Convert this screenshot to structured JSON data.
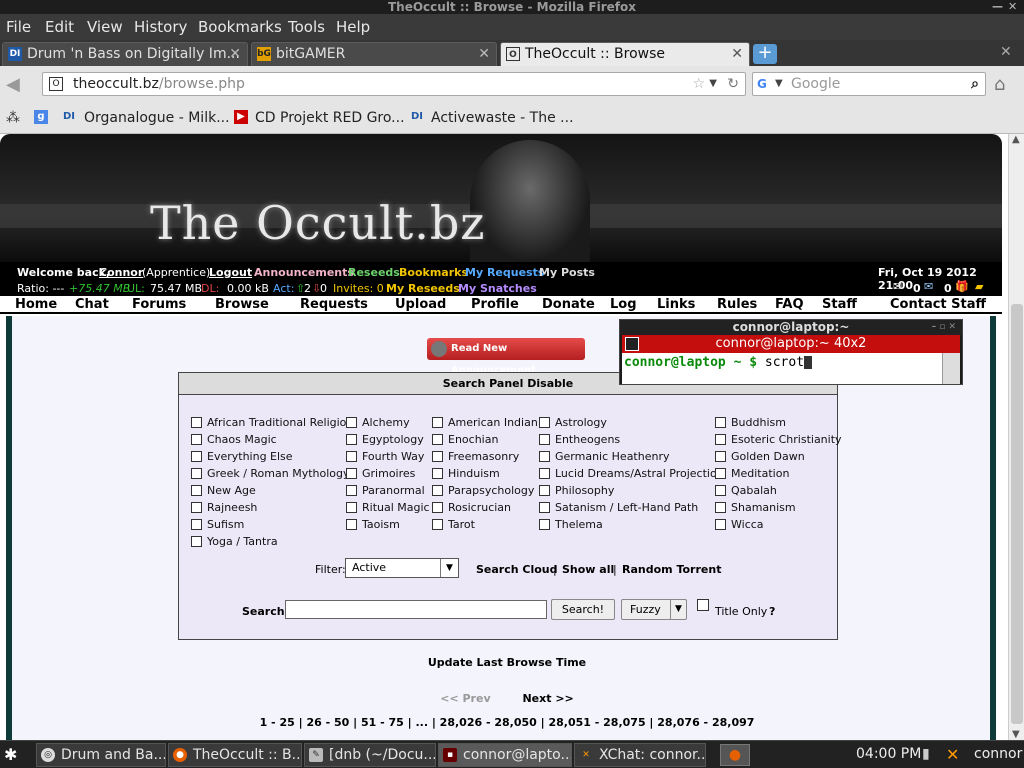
{
  "window": {
    "title": "TheOccult :: Browse - Mozilla Firefox"
  },
  "menu": [
    "File",
    "Edit",
    "View",
    "History",
    "Bookmarks",
    "Tools",
    "Help"
  ],
  "tabs": [
    {
      "label": "Drum 'n Bass on Digitally Im...",
      "icon": "DI"
    },
    {
      "label": "bitGAMER",
      "icon": "bG"
    },
    {
      "label": "TheOccult :: Browse",
      "icon": "O"
    }
  ],
  "nav": {
    "url_host": "theoccult.bz",
    "url_path": "/browse.php",
    "search_placeholder": "Google"
  },
  "bookmarks": [
    {
      "label": "Organalogue - Milk...",
      "icon": "DI"
    },
    {
      "label": "CD Projekt RED Gro...",
      "icon": "▶"
    },
    {
      "label": "Activewaste - The ...",
      "icon": "DI"
    }
  ],
  "site": {
    "logo": "The Occult.bz",
    "userbar": {
      "welcome": "Welcome back,",
      "user": "Connor",
      "rank": "(Apprentice)",
      "logout": "Logout",
      "announcements": "Announcements",
      "reseeds": "Reseeds",
      "bookmarks": "Bookmarks",
      "my_requests": "My Requests",
      "my_posts": "My Posts",
      "date": "Fri, Oct 19 2012 21:00",
      "ratio_label": "Ratio: ---",
      "ratio_value": "+75.47 MB",
      "ul_label": "UL:",
      "ul_value": "75.47 MB",
      "dl_label": "DL:",
      "dl_value": "0.00 kB",
      "act_label": "Act:",
      "act_up": "2",
      "act_down": "0",
      "invites": "Invites: 0",
      "my_reseeds": "My Reseeds",
      "my_snatches": "My Snatches",
      "msg_count": "0",
      "gift_count": "0"
    },
    "nav": [
      "Home",
      "Chat",
      "Forums",
      "Browse",
      "Requests",
      "Upload",
      "Profile",
      "Donate",
      "Log",
      "Links",
      "Rules",
      "FAQ",
      "Staff",
      "Contact Staff"
    ],
    "announce_button": "Read New Announcement.",
    "panel_title": "Search Panel Disable",
    "categories": [
      [
        "African Traditional Religion",
        "Chaos Magic",
        "Everything Else",
        "Greek / Roman Mythology",
        "New Age",
        "Rajneesh",
        "Sufism",
        "Yoga / Tantra"
      ],
      [
        "Alchemy",
        "Egyptology",
        "Fourth Way",
        "Grimoires",
        "Paranormal",
        "Ritual Magic",
        "Taoism"
      ],
      [
        "American Indian",
        "Enochian",
        "Freemasonry",
        "Hinduism",
        "Parapsychology",
        "Rosicrucian",
        "Tarot"
      ],
      [
        "Astrology",
        "Entheogens",
        "Germanic Heathenry",
        "Lucid Dreams/Astral Projection",
        "Philosophy",
        "Satanism / Left-Hand Path",
        "Thelema"
      ],
      [
        "Buddhism",
        "Esoteric Christianity",
        "Golden Dawn",
        "Meditation",
        "Qabalah",
        "Shamanism",
        "Wicca"
      ]
    ],
    "filter_label": "Filter:",
    "filter_value": "Active",
    "search_cloud": "Search Cloud",
    "show_all": "Show all",
    "random_torrent": "Random Torrent",
    "search_label": "Search:",
    "search_button": "Search!",
    "fuzzy": "Fuzzy",
    "title_only": "Title Only",
    "help": "?",
    "update_browse": "Update Last Browse Time",
    "prev": "<< Prev",
    "next": "Next >>",
    "pages": "1 - 25 | 26 - 50 | 51 - 75 | ... | 28,026 - 28,050 | 28,051 - 28,075 | 28,076 - 28,097"
  },
  "terminal": {
    "title": "connor@laptop:~",
    "bar": "connor@laptop:~ 40x2",
    "prompt": "connor@laptop ~ $",
    "command": "scrot"
  },
  "taskbar": [
    {
      "label": "Drum and Ba...",
      "icon": "chrome"
    },
    {
      "label": "TheOccult :: B...",
      "icon": "firefox"
    },
    {
      "label": "[dnb (~/Docu...",
      "icon": "editor"
    },
    {
      "label": "connor@lapto...",
      "icon": "terminal"
    },
    {
      "label": "XChat: connor...",
      "icon": "xchat"
    }
  ],
  "clock": "04:00 PM",
  "tray_user": "connor"
}
